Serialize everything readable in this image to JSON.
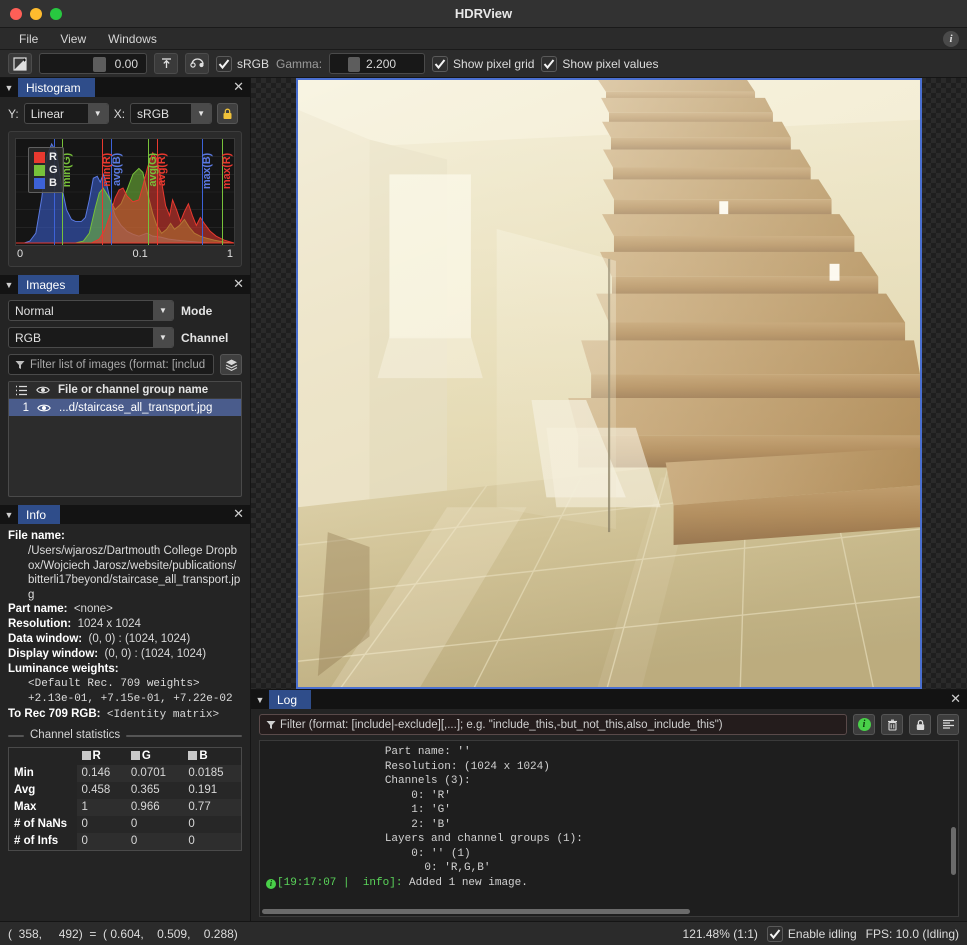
{
  "window": {
    "title": "HDRView",
    "traffic_lights": [
      "close",
      "minimize",
      "zoom"
    ]
  },
  "menubar": {
    "items": [
      {
        "label": "File"
      },
      {
        "label": "View"
      },
      {
        "label": "Windows"
      }
    ],
    "info_icon": "i"
  },
  "toolbar": {
    "exposure_icon": "exposure-icon",
    "exposure_value": "0.00",
    "normalize_icon": "arrow-up-icon",
    "reset_icon": "reset-exposure-icon",
    "srgb_checked": true,
    "srgb_label": "sRGB",
    "gamma_label": "Gamma:",
    "gamma_value": "2.200",
    "pixel_grid_checked": true,
    "pixel_grid_label": "Show pixel grid",
    "pixel_values_checked": true,
    "pixel_values_label": "Show pixel values"
  },
  "histogram": {
    "title": "Histogram",
    "y_label": "Y:",
    "y_value": "Linear",
    "x_label": "X:",
    "x_value": "sRGB",
    "lock_icon": "lock-icon",
    "axis_min": "0",
    "axis_mid": "0.1",
    "axis_max": "1",
    "legend": [
      {
        "name": "R",
        "color": "#e8392f"
      },
      {
        "name": "G",
        "color": "#77c13a"
      },
      {
        "name": "B",
        "color": "#3d62d8"
      }
    ],
    "markers": [
      {
        "label": "min(G)",
        "color": "#77c13a",
        "pos": 0.175
      },
      {
        "label": "min(R)",
        "color": "#e8392f",
        "pos": 0.395
      },
      {
        "label": "avg(B)",
        "color": "#5b7ae0",
        "pos": 0.435
      },
      {
        "label": "avg(G)",
        "color": "#77c13a",
        "pos": 0.605
      },
      {
        "label": "avg(R)",
        "color": "#e8392f",
        "pos": 0.645
      },
      {
        "label": "max(B)",
        "color": "#5b7ae0",
        "pos": 0.855
      },
      {
        "label": "max(R)",
        "color": "#e8392f",
        "pos": 0.945
      }
    ]
  },
  "images": {
    "title": "Images",
    "mode_value": "Normal",
    "mode_label": "Mode",
    "channel_value": "RGB",
    "channel_label": "Channel",
    "filter_placeholder": "Filter list of images (format: [includ",
    "filter_icon": "funnel-icon",
    "layers_icon": "layers-icon",
    "list_header": "File or channel group name",
    "list_header_icon": "list-icon",
    "eye_icon": "eye-icon",
    "rows": [
      {
        "index": "1",
        "name": "...d/staircase_all_transport.jpg",
        "selected": true
      }
    ]
  },
  "info": {
    "title": "Info",
    "file_name_label": "File name:",
    "file_name_value": "/Users/wjarosz/Dartmouth College Dropbox/Wojciech Jarosz/website/publications/bitterli17beyond/staircase_all_transport.jpg",
    "part_name_label": "Part name:",
    "part_name_value": "<none>",
    "resolution_label": "Resolution:",
    "resolution_value": "1024 x 1024",
    "data_window_label": "Data window:",
    "data_window_value": "(0, 0) : (1024, 1024)",
    "display_window_label": "Display window:",
    "display_window_value": "(0, 0) : (1024, 1024)",
    "luminance_label": "Luminance weights:",
    "luminance_default": "<Default Rec. 709 weights>",
    "luminance_values": "+2.13e-01, +7.15e-01, +7.22e-02",
    "rec709_label": "To Rec 709 RGB:",
    "rec709_value": "<Identity matrix>",
    "stats_title": "Channel statistics",
    "stats_columns": [
      "R",
      "G",
      "B"
    ],
    "stats_rows": [
      {
        "label": "Min",
        "values": [
          "0.146",
          "0.0701",
          "0.0185"
        ]
      },
      {
        "label": "Avg",
        "values": [
          "0.458",
          "0.365",
          "0.191"
        ]
      },
      {
        "label": "Max",
        "values": [
          "1",
          "0.966",
          "0.77"
        ]
      },
      {
        "label": "# of NaNs",
        "values": [
          "0",
          "0",
          "0"
        ]
      },
      {
        "label": "# of Infs",
        "values": [
          "0",
          "0",
          "0"
        ]
      }
    ]
  },
  "log": {
    "title": "Log",
    "filter_placeholder": "Filter (format: [include|-exclude][,...]; e.g. \"include_this,-but_not_this,also_include_this\")",
    "filter_icon": "funnel-icon",
    "info_icon": "info-level-icon",
    "trash_icon": "trash-icon",
    "lock_icon": "lock-icon",
    "wrap_icon": "align-lines-icon",
    "lines": [
      "                  Part name: ''",
      "                  Resolution: (1024 x 1024)",
      "                  Channels (3):",
      "                      0: 'R'",
      "                      1: 'G'",
      "                      2: 'B'",
      "                  Layers and channel groups (1):",
      "                      0: '' (1)",
      "                        0: 'R,G,B'"
    ],
    "last_entry_time": "[19:17:07 |  info]:",
    "last_entry_text": " Added 1 new image."
  },
  "statusbar": {
    "coords": "(  358,     492)  =  ( 0.604,    0.509,    0.288)",
    "zoom": "121.48% (1:1)",
    "idling_checked": true,
    "idling_label": "Enable idling",
    "fps": "FPS: 10.0 (Idling)"
  },
  "colors": {
    "accent": "#2f4d8a",
    "selection": "#4a5c8c",
    "image_border": "#4a6fd0",
    "log_green": "#5ad45a"
  }
}
